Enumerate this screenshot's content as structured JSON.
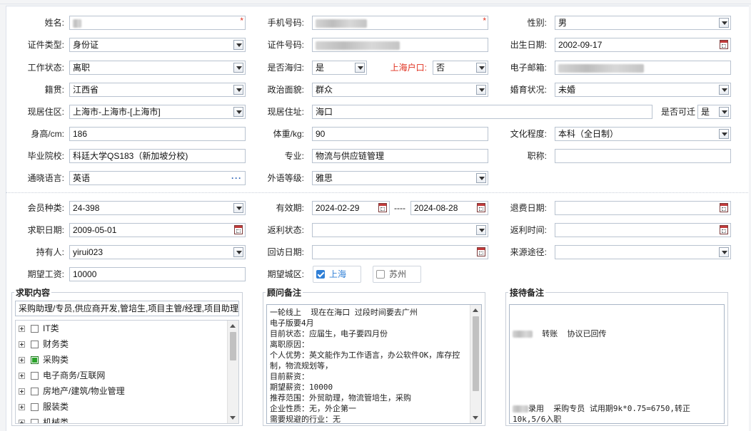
{
  "basic": {
    "name_label": "姓名:",
    "phone_label": "手机号码:",
    "gender_label": "性别:",
    "gender_value": "男",
    "idtype_label": "证件类型:",
    "idtype_value": "身份证",
    "idno_label": "证件号码:",
    "birth_label": "出生日期:",
    "birth_value": "2002-09-17",
    "workstatus_label": "工作状态:",
    "workstatus_value": "离职",
    "returnee_label": "是否海归:",
    "returnee_value": "是",
    "shhukou_label": "上海户口:",
    "shhukou_value": "否",
    "email_label": "电子邮箱:",
    "native_label": "籍贯:",
    "native_value": "江西省",
    "political_label": "政治面貌:",
    "political_value": "群众",
    "marital_label": "婚育状况:",
    "marital_value": "未婚",
    "residence_label": "现居住区:",
    "residence_value": "上海市-上海市-[上海市]",
    "address_label": "现居住址:",
    "address_value": "海口",
    "reachable_label": "是否可迁",
    "reachable_value": "是",
    "height_label": "身高/cm:",
    "height_value": "186",
    "weight_label": "体重/kg:",
    "weight_value": "90",
    "education_label": "文化程度:",
    "education_value": "本科（全日制）",
    "school_label": "毕业院校:",
    "school_value": "科廷大学QS183（新加坡分校)",
    "major_label": "专业:",
    "major_value": "物流与供应链管理",
    "title_label": "职称:",
    "language_label": "通晓语言:",
    "language_value": "英语",
    "langlevel_label": "外语等级:",
    "langlevel_value": "雅思"
  },
  "member": {
    "type_label": "会员种类:",
    "type_value": "24-398",
    "valid_label": "有效期:",
    "valid_from": "2024-02-29",
    "valid_sep": "----",
    "valid_to": "2024-08-28",
    "refund_label": "退费日期:",
    "jobdate_label": "求职日期:",
    "jobdate_value": "2009-05-01",
    "rebate_label": "返利状态:",
    "rebatetime_label": "返利时间:",
    "holder_label": "持有人:",
    "holder_value": "yirui023",
    "visit_label": "回访日期:",
    "source_label": "来源途径:",
    "salary_label": "期望工资:",
    "salary_value": "10000",
    "city_label": "期望城区:",
    "city_shanghai": "上海",
    "city_suzhou": "苏州"
  },
  "job": {
    "title": "求职内容",
    "summary": "采购助理/专员,供应商开发,管培生,项目主管/经理,项目助理",
    "tree": [
      {
        "label": "IT类",
        "checked": false
      },
      {
        "label": "财务类",
        "checked": false
      },
      {
        "label": "采购类",
        "checked": true
      },
      {
        "label": "电子商务/互联网",
        "checked": false
      },
      {
        "label": "房地产/建筑/物业管理",
        "checked": false
      },
      {
        "label": "服装类",
        "checked": false
      },
      {
        "label": "机械类",
        "checked": false
      }
    ]
  },
  "advisor": {
    "title": "顾问备注",
    "text": "一轮线上  现在在海口 过段时间要去广州\n电子版要4月\n目前状态：应届生，电子要四月份\n离职原因：\n个人优势：英文能作为工作语言，办公软件OK，库存控制，物流规划等，\n目前薪资：\n期望薪资：10000\n推荐范围：外贸助理，物流管培生，采购\n企业性质：无，外企第一\n需要规避的行业：无"
  },
  "reception": {
    "title": "接待备注",
    "line1": "转账  协议已回传",
    "line2": "录用  采购专员 试用期9k*0.75=6750,转正10k,5/6入职"
  },
  "colors": {
    "accent": "#2f7fd6",
    "required": "#e0311f",
    "border": "#b9c3d0"
  }
}
